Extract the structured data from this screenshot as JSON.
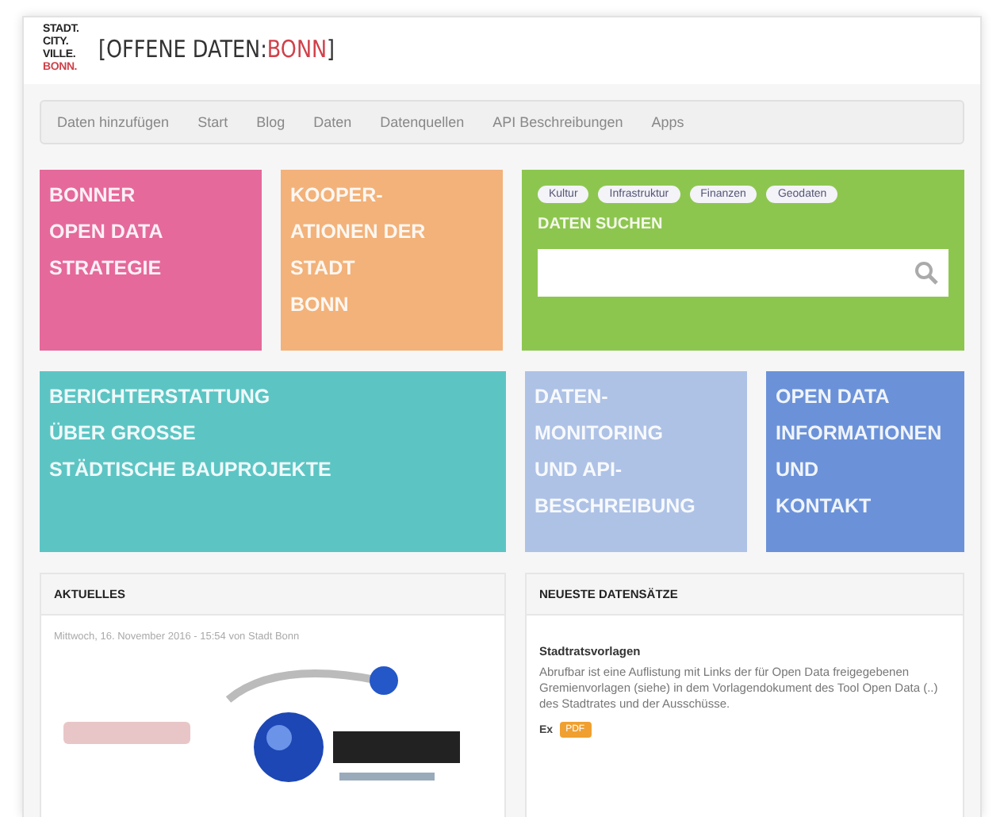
{
  "header": {
    "logo_lines": [
      {
        "text": "STADT.",
        "kind": "plain"
      },
      {
        "text": "CITY.",
        "kind": "plain"
      },
      {
        "text": "VILLE.",
        "kind": "plain"
      },
      {
        "text": "BONN.",
        "kind": "accent"
      }
    ],
    "title_parts": [
      {
        "text": "[OFFENE DATEN:",
        "kind": "plain"
      },
      {
        "text": "BONN",
        "kind": "accent"
      },
      {
        "text": "]",
        "kind": "plain"
      }
    ]
  },
  "nav": [
    "Daten hinzufügen",
    "Start",
    "Blog",
    "Daten",
    "Datenquellen",
    "API Beschreibungen",
    "Apps"
  ],
  "tiles_row_1": [
    {
      "kind": "text",
      "color": "#e5699b",
      "lines": [
        "BONNER",
        "OPEN DATA",
        "STRATEGIE"
      ]
    },
    {
      "kind": "text",
      "color": "#f2b27a",
      "lines": [
        "KOOPER-",
        "ATIONEN DER",
        "STADT",
        "BONN"
      ]
    },
    {
      "kind": "search",
      "color": "#8dc64f",
      "tags": [
        "Kultur",
        "Infrastruktur",
        "Finanzen",
        "Geodaten"
      ],
      "heading": "DATEN SUCHEN"
    }
  ],
  "tiles_row_2": [
    {
      "kind": "text",
      "color": "#5cc5c4",
      "lines": [
        "BERICHTERSTATTUNG",
        "ÜBER GROSSE",
        "STÄDTISCHE BAUPROJEKTE"
      ]
    },
    {
      "kind": "text",
      "color": "#aec2e6",
      "lines": [
        "DATEN-",
        "MONITORING",
        "UND API-",
        "BESCHREIBUNG"
      ]
    },
    {
      "kind": "text",
      "color": "#6b92d8",
      "lines": [
        "OPEN DATA",
        "INFORMATIONEN",
        "UND",
        "KONTAKT"
      ]
    }
  ],
  "news": {
    "title": "AKTUELLES",
    "meta": "Mittwoch, 16. November 2016 - 15:54 von Stadt Bonn"
  },
  "datasets": {
    "title": "NEUESTE DATENSÄTZE",
    "item": {
      "name": "Stadtratsvorlagen",
      "description": "Abrufbar ist eine Auflistung mit Links der für Open Data freigegebenen Gremienvorlagen (siehe) in dem Vorlagendokument des Tool Open Data (..) des Stadtrates und der Ausschüsse.",
      "format_label": "Ex",
      "format": "PDF"
    }
  }
}
